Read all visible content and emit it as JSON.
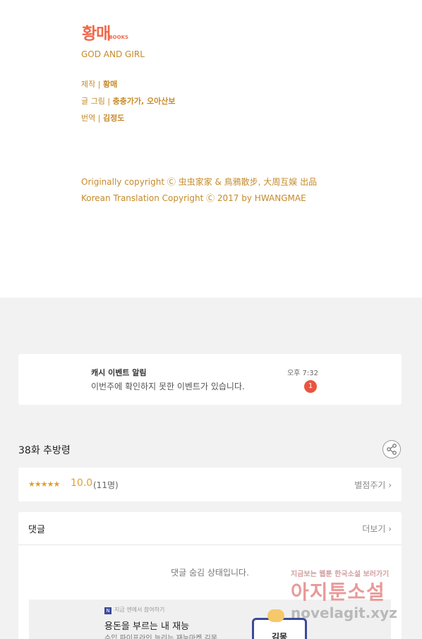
{
  "credits": {
    "logo_main": "황매",
    "logo_sub": "BOOKS",
    "series_title": "GOD AND GIRL",
    "rows": [
      {
        "label": "제작 | ",
        "value": "황매"
      },
      {
        "label": "글 그림 | ",
        "value": "충충가가, 오아산보"
      },
      {
        "label": "번역 | ",
        "value": "김정도"
      }
    ],
    "copyright_1": "Originally copyright Ⓒ 虫虫家家 & 鳥鴉散步, 大周互娱 出品",
    "copyright_2": "Korean Translation Copyright Ⓒ 2017 by HWANGMAE"
  },
  "notification": {
    "title": "캐시 이벤트 알림",
    "time": "오후 7:32",
    "body": "이번주에 확인하지 못한 이벤트가 있습니다.",
    "badge": "1"
  },
  "episode": {
    "title": "38화 추방령",
    "share_icon": "share-icon"
  },
  "rating": {
    "stars": "★★★★★",
    "score": "10.0",
    "count": "(11명)",
    "rate_label": "별점주기"
  },
  "comments": {
    "title": "댓글",
    "more_label": "더보기",
    "hidden_text": "댓글 숨김 상태입니다."
  },
  "ad": {
    "tag": "지금 엔에서 참여하기",
    "title": "용돈을 부르는 내 재능",
    "subtitle": "수입 파이프라인 늘리는 재능마켓 김몽",
    "book_text": "김몽"
  },
  "watermark": {
    "top": "지금보는 웹툰 한국소설 보러가기",
    "logo": "아지툰소설",
    "url": "novelagit.xyz"
  },
  "colors": {
    "credit_gold": "#c58a2a",
    "logo_orange": "#ef6a4b",
    "badge_red": "#e8553f",
    "star_gold": "#e0a030",
    "background_gray": "#f2f2f2"
  }
}
